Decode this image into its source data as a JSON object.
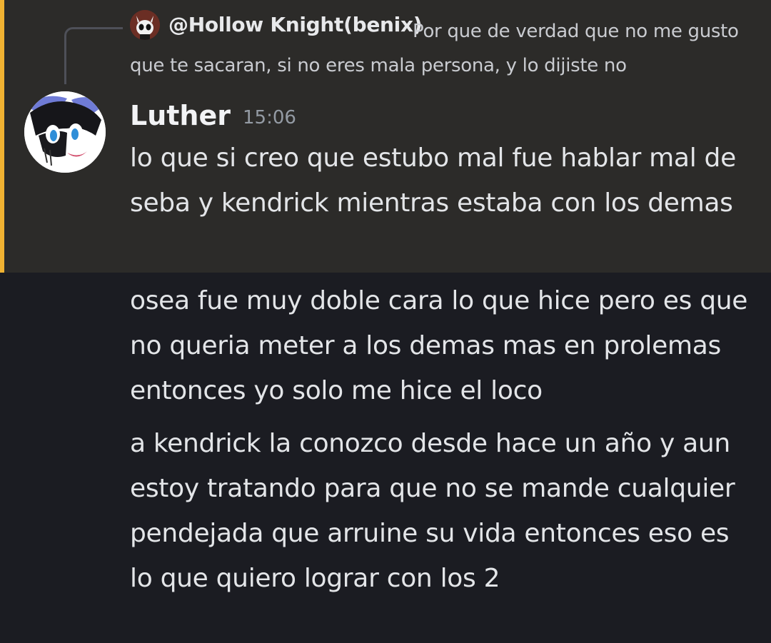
{
  "reply": {
    "author": "@Hollow Knight(benix)",
    "text": "Por que de verdad que no me gusto que te sacaran, si no eres mala persona, y lo dijiste no"
  },
  "message": {
    "author": "Luther",
    "timestamp": "15:06",
    "lines": [
      "lo que si creo que estubo mal fue hablar mal de seba y kendrick mientras estaba con los demas",
      "osea fue muy doble cara lo que hice pero es que no queria meter a los demas mas en prolemas entonces yo solo me hice el loco",
      "a kendrick la conozco desde hace un año y aun estoy tratando para que no se mande cualquier pendejada que arruine su vida entonces eso es lo que quiero lograr con los 2"
    ]
  },
  "colors": {
    "highlight_bg": "#2c2b29",
    "highlight_bar": "#f0b232",
    "chat_bg": "#1b1c22",
    "text": "#e3e5e8",
    "timestamp": "#949ba4"
  },
  "icons": {
    "reply_avatar": "hollow-knight-avatar",
    "author_avatar": "luther-avatar"
  }
}
